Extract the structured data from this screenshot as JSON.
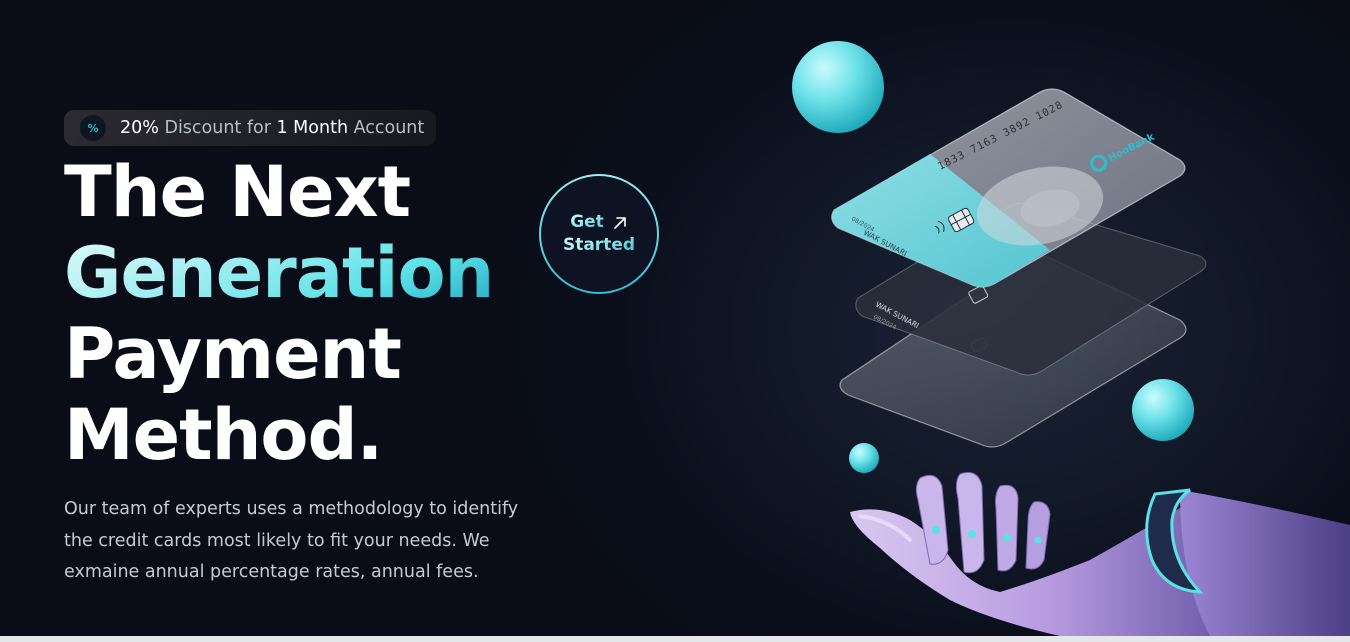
{
  "badge": {
    "icon": "percent-icon",
    "parts": [
      "20%",
      " Discount for ",
      "1 Month",
      " Account"
    ]
  },
  "headline": {
    "line1": "The Next",
    "line2": "Generation",
    "line3": "Payment",
    "line4": "Method."
  },
  "description": "Our team of experts uses a methodology to identify the credit cards most likely to fit your needs. We exmaine annual percentage rates, annual fees.",
  "cta": {
    "line1": "Get",
    "line2": "Started",
    "icon": "arrow-up-right-icon"
  },
  "card": {
    "brand": "HooBank",
    "number": "1833 7163 3892 1028",
    "holder": "WAK SUNARI",
    "expiry": "08/2024"
  },
  "colors": {
    "accent": "#33bbcf",
    "accent_light": "#5ce1e6",
    "background": "#00040f"
  }
}
